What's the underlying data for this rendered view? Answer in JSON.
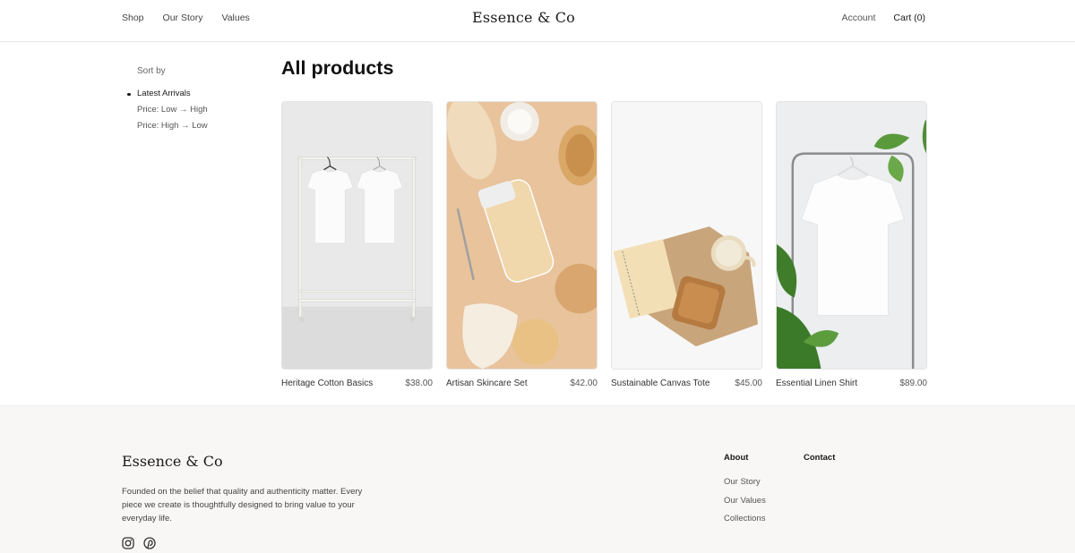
{
  "header": {
    "nav_left": [
      "Shop",
      "Our Story",
      "Values"
    ],
    "brand": "Essence & Co",
    "account": "Account",
    "cart": "Cart (0)"
  },
  "sidebar": {
    "title": "Sort by",
    "options": [
      {
        "label": "Latest Arrivals",
        "active": true
      },
      {
        "label": "Price: Low → High",
        "active": false
      },
      {
        "label": "Price: High → Low",
        "active": false
      }
    ]
  },
  "main": {
    "title": "All products",
    "products": [
      {
        "name": "Heritage Cotton Basics",
        "price": "$38.00",
        "image": "white-tshirts-on-rack"
      },
      {
        "name": "Artisan Skincare Set",
        "price": "$42.00",
        "image": "skincare-flatlay"
      },
      {
        "name": "Sustainable Canvas Tote",
        "price": "$45.00",
        "image": "notebook-and-mug"
      },
      {
        "name": "Essential Linen Shirt",
        "price": "$89.00",
        "image": "tshirt-on-hanger-with-plant"
      }
    ]
  },
  "footer": {
    "brand": "Essence & Co",
    "description": "Founded on the belief that quality and authenticity matter. Every piece we create is thoughtfully designed to bring value to your everyday life.",
    "social": [
      "instagram-icon",
      "pinterest-icon"
    ],
    "columns": [
      {
        "title": "About",
        "links": [
          "Our Story",
          "Our Values",
          "Collections"
        ]
      },
      {
        "title": "Contact",
        "links": []
      }
    ]
  }
}
